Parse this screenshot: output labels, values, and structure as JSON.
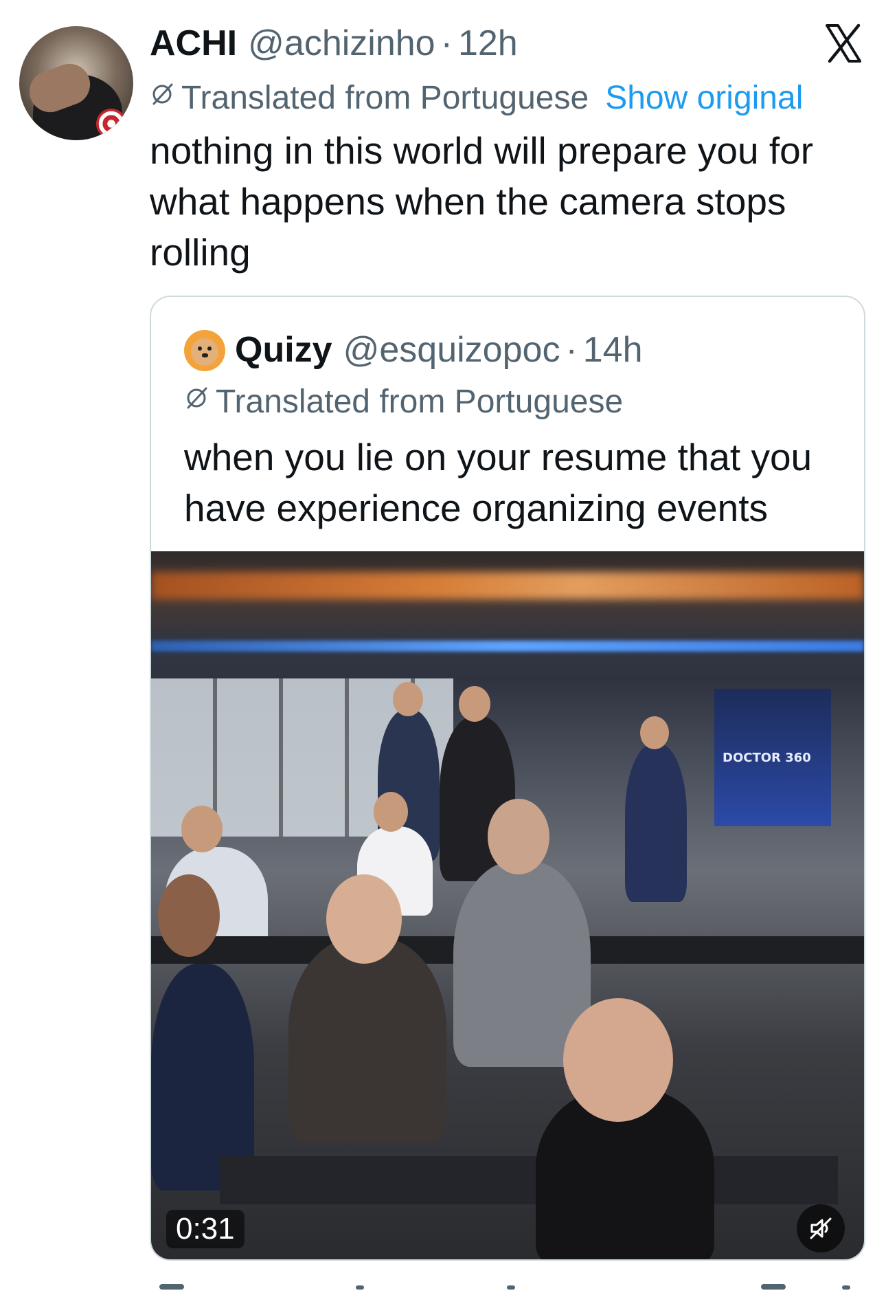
{
  "tweet": {
    "author_name": "ACHI",
    "author_handle": "@achizinho",
    "separator": "·",
    "time": "12h",
    "translation_note": "Translated from Portuguese",
    "show_original": "Show original",
    "text": "nothing in this world will prepare you for what happens when the camera stops rolling"
  },
  "quoted_tweet": {
    "author_name": "Quizy",
    "author_handle": "@esquizopoc",
    "separator": "·",
    "time": "14h",
    "translation_note": "Translated from Portuguese",
    "text": "when you lie on your resume that you have experience organizing events",
    "video": {
      "duration": "0:31",
      "banner_text": "DOCTOR 360",
      "muted": true
    }
  },
  "icons": {
    "brand": "x-logo-icon",
    "translate": "translate-slash-icon",
    "mute": "speaker-muted-icon"
  },
  "colors": {
    "text_primary": "#0f1419",
    "text_secondary": "#536471",
    "link": "#1d9bf0",
    "border": "#cfd9de"
  }
}
